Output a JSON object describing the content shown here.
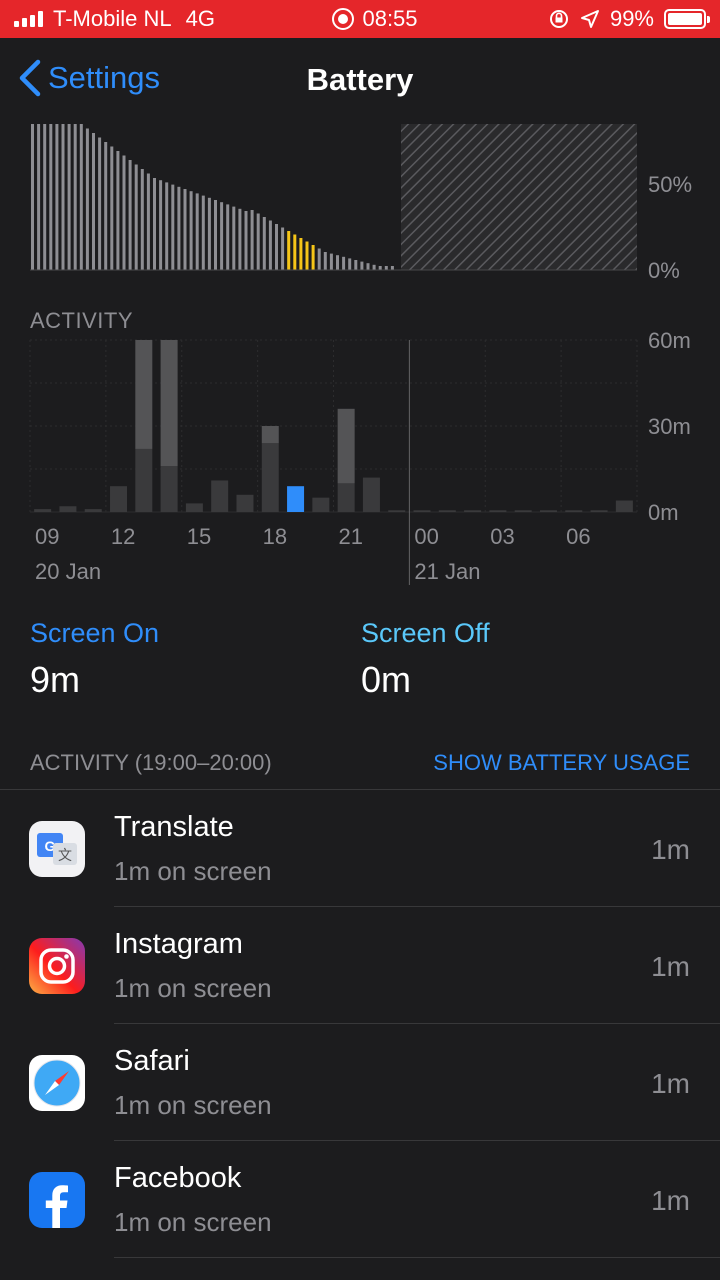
{
  "status_bar": {
    "carrier": "T-Mobile NL",
    "network": "4G",
    "time": "08:55",
    "battery_percent": "99%"
  },
  "nav": {
    "back_label": "Settings",
    "title": "Battery"
  },
  "level_chart": {
    "y_labels": [
      "50%",
      "0%"
    ]
  },
  "activity_chart": {
    "section_label": "ACTIVITY",
    "y_labels": [
      "60m",
      "30m",
      "0m"
    ],
    "x_labels": [
      "09",
      "12",
      "15",
      "18",
      "21",
      "00",
      "03",
      "06"
    ],
    "date_labels": [
      "20 Jan",
      "21 Jan"
    ]
  },
  "chart_data": {
    "type": "bar",
    "x": [
      "09",
      "10",
      "11",
      "12",
      "13",
      "14",
      "15",
      "16",
      "17",
      "18",
      "19",
      "20",
      "21",
      "22",
      "23",
      "00",
      "01",
      "02",
      "03",
      "04",
      "05",
      "06",
      "07",
      "08"
    ],
    "series": [
      {
        "name": "Screen On",
        "values": [
          1,
          2,
          1,
          9,
          22,
          16,
          3,
          11,
          6,
          24,
          9,
          5,
          10,
          12,
          0,
          0,
          0,
          0,
          0,
          0,
          0,
          0,
          0,
          4
        ]
      },
      {
        "name": "Screen Off",
        "values": [
          0,
          0,
          0,
          0,
          38,
          44,
          0,
          0,
          0,
          6,
          0,
          0,
          26,
          0,
          0,
          0,
          0,
          0,
          0,
          0,
          0,
          0,
          0,
          0
        ]
      }
    ],
    "highlight": "19",
    "ylim": [
      0,
      60
    ],
    "y_ticks": [
      "60m",
      "30m",
      "0m"
    ],
    "grid": true
  },
  "screen_on": {
    "label": "Screen On",
    "value": "9m"
  },
  "screen_off": {
    "label": "Screen Off",
    "value": "0m"
  },
  "usage": {
    "title": "ACTIVITY (19:00–20:00)",
    "link": "SHOW BATTERY USAGE",
    "apps": [
      {
        "name": "Translate",
        "sub": "1m on screen",
        "time": "1m",
        "icon": "translate-icon"
      },
      {
        "name": "Instagram",
        "sub": "1m on screen",
        "time": "1m",
        "icon": "instagram-icon"
      },
      {
        "name": "Safari",
        "sub": "1m on screen",
        "time": "1m",
        "icon": "safari-icon"
      },
      {
        "name": "Facebook",
        "sub": "1m on screen",
        "time": "1m",
        "icon": "facebook-icon"
      }
    ]
  },
  "colors": {
    "status_bar": "#e5262a",
    "accent": "#2f8dfa",
    "screen_off": "#5ac8fa",
    "charging": "#f5c518"
  }
}
